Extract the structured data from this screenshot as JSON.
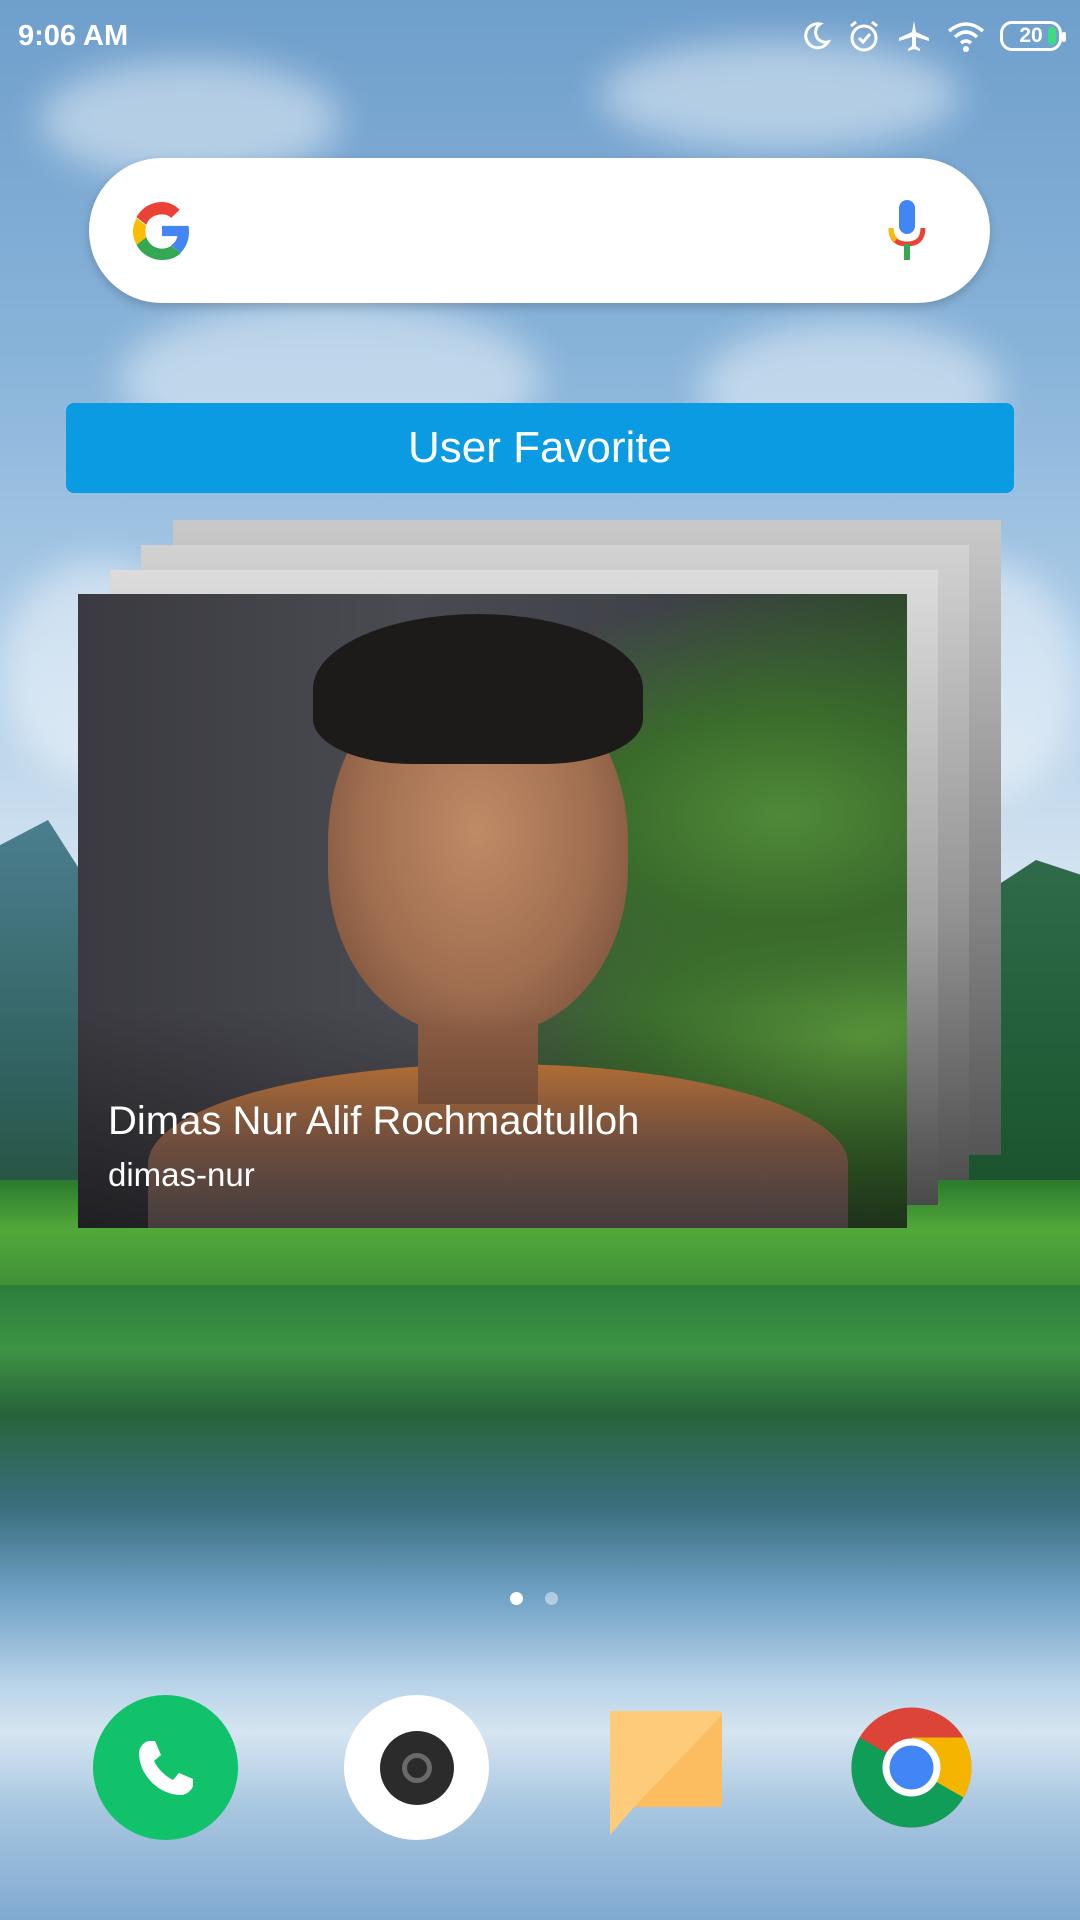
{
  "status_bar": {
    "time": "9:06 AM",
    "battery_level": "20",
    "icons": [
      "moon-icon",
      "alarm-icon",
      "airplane-mode-icon",
      "wifi-icon",
      "battery-icon"
    ]
  },
  "search_widget": {
    "logo": "google-logo-icon",
    "mic": "microphone-icon"
  },
  "favorite_widget": {
    "title": "User Favorite",
    "user": {
      "name": "Dimas Nur Alif Rochmadtulloh",
      "username": "dimas-nur"
    }
  },
  "home": {
    "pages": 2,
    "current_page": 1
  },
  "dock": {
    "apps": [
      "phone-app",
      "camera-app",
      "messaging-app",
      "chrome-app"
    ]
  },
  "colors": {
    "widget_header": "#0a9be3",
    "phone_green": "#12c26a",
    "battery_fill": "#3ddc84"
  }
}
